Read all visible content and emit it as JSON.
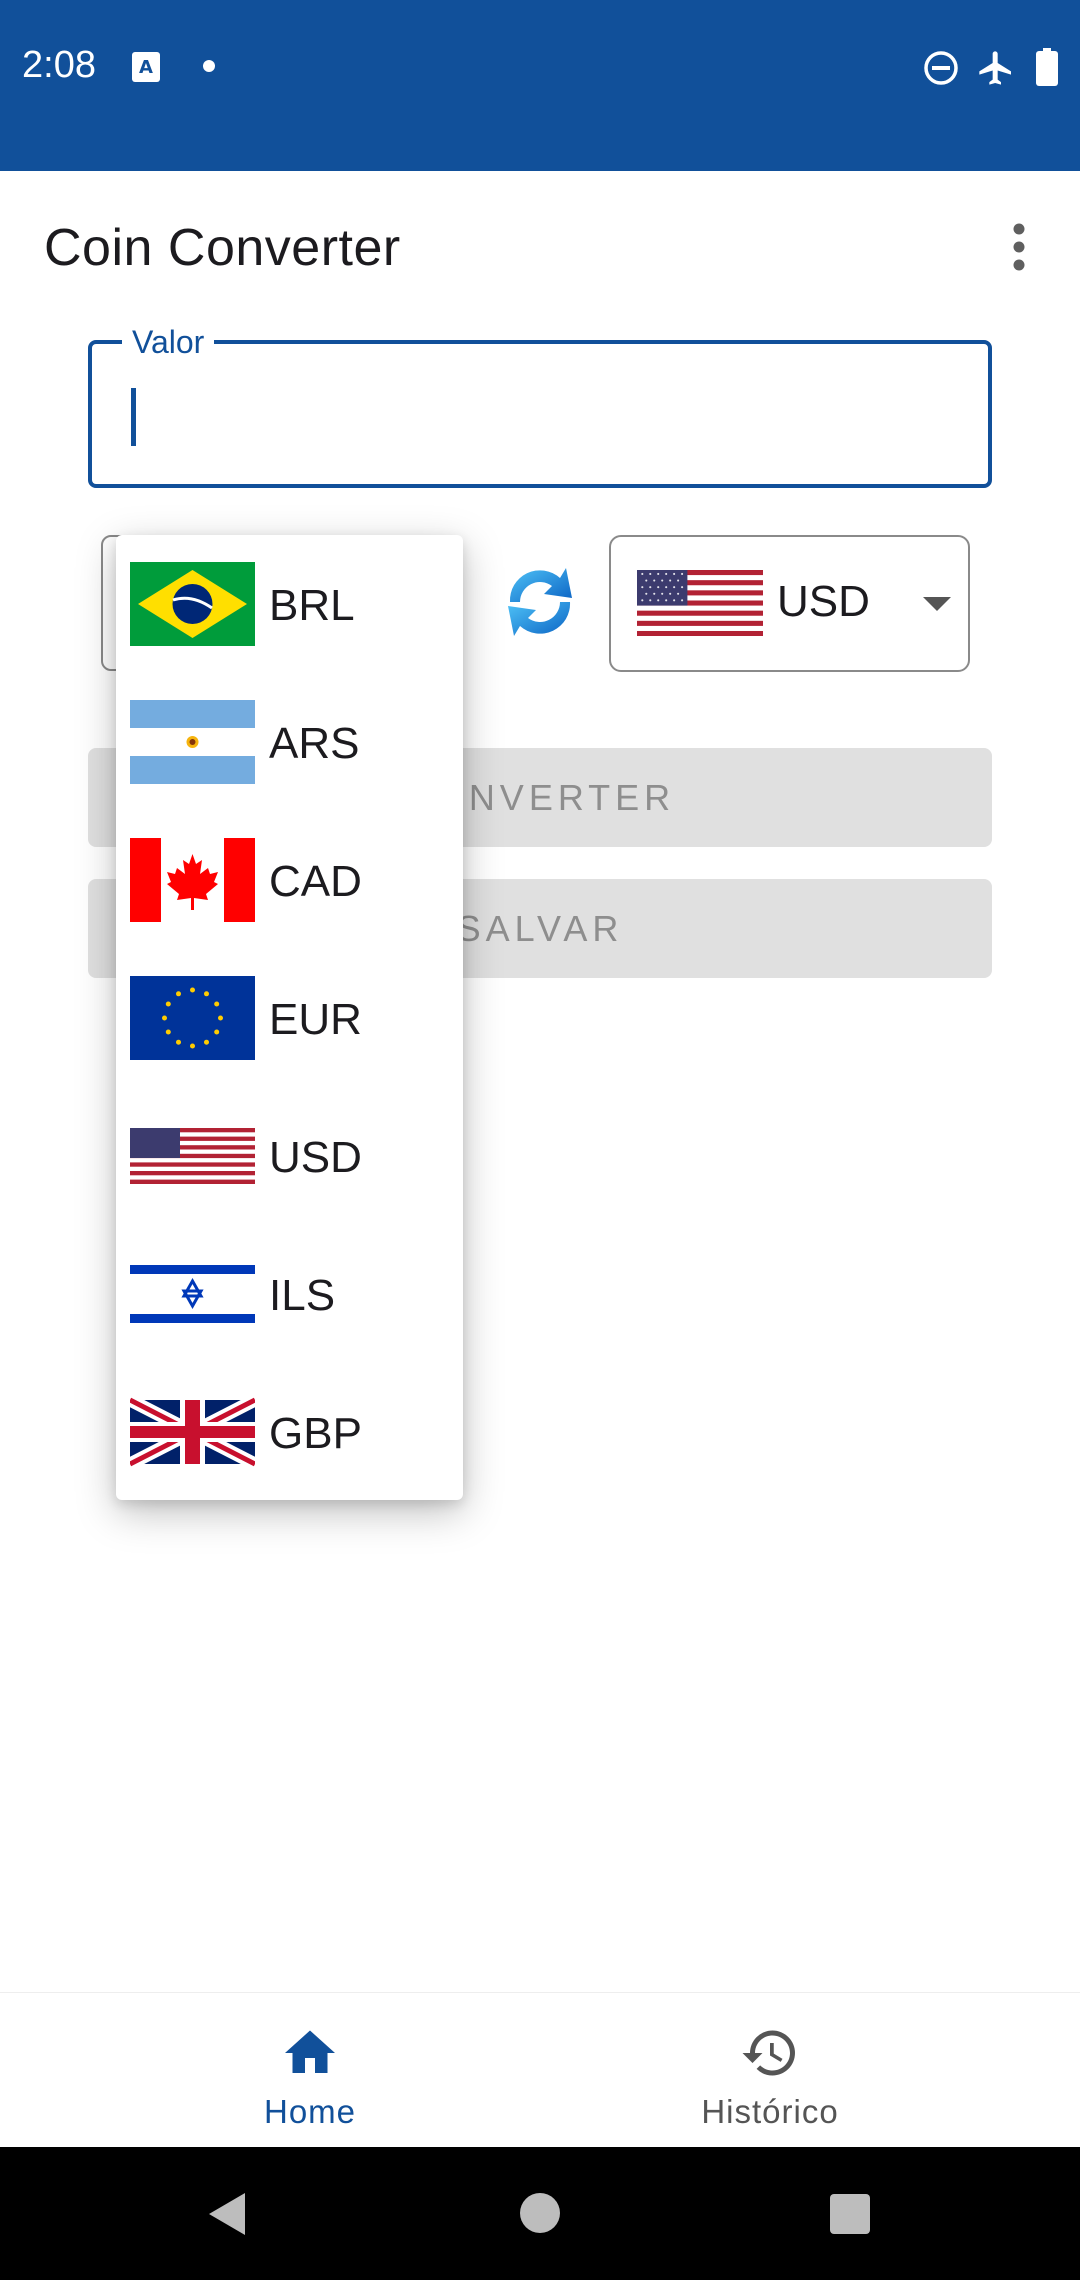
{
  "status_bar": {
    "time": "2:08",
    "icons": [
      "text-a-icon",
      "dot-icon",
      "do-not-disturb-icon",
      "airplane-icon",
      "battery-icon"
    ],
    "background": "#11509a"
  },
  "app_bar": {
    "title": "Coin Converter",
    "menu_icon": "more-vert-icon"
  },
  "value_field": {
    "label": "Valor",
    "value": ""
  },
  "to_currency": {
    "code": "USD",
    "flag": "us-flag"
  },
  "swap_icon": "swap-arrows-icon",
  "buttons": {
    "convert": "CONVERTER",
    "save": "SALVAR"
  },
  "dropdown": {
    "items": [
      {
        "code": "BRL",
        "flag": "brazil-flag"
      },
      {
        "code": "ARS",
        "flag": "argentina-flag"
      },
      {
        "code": "CAD",
        "flag": "canada-flag"
      },
      {
        "code": "EUR",
        "flag": "eu-flag"
      },
      {
        "code": "USD",
        "flag": "us-flag"
      },
      {
        "code": "ILS",
        "flag": "israel-flag"
      },
      {
        "code": "GBP",
        "flag": "uk-flag"
      }
    ]
  },
  "bottom_nav": {
    "home": "Home",
    "history": "Histórico",
    "active": "home"
  },
  "colors": {
    "primary": "#11509a",
    "button_disabled": "#e0e0e0"
  }
}
